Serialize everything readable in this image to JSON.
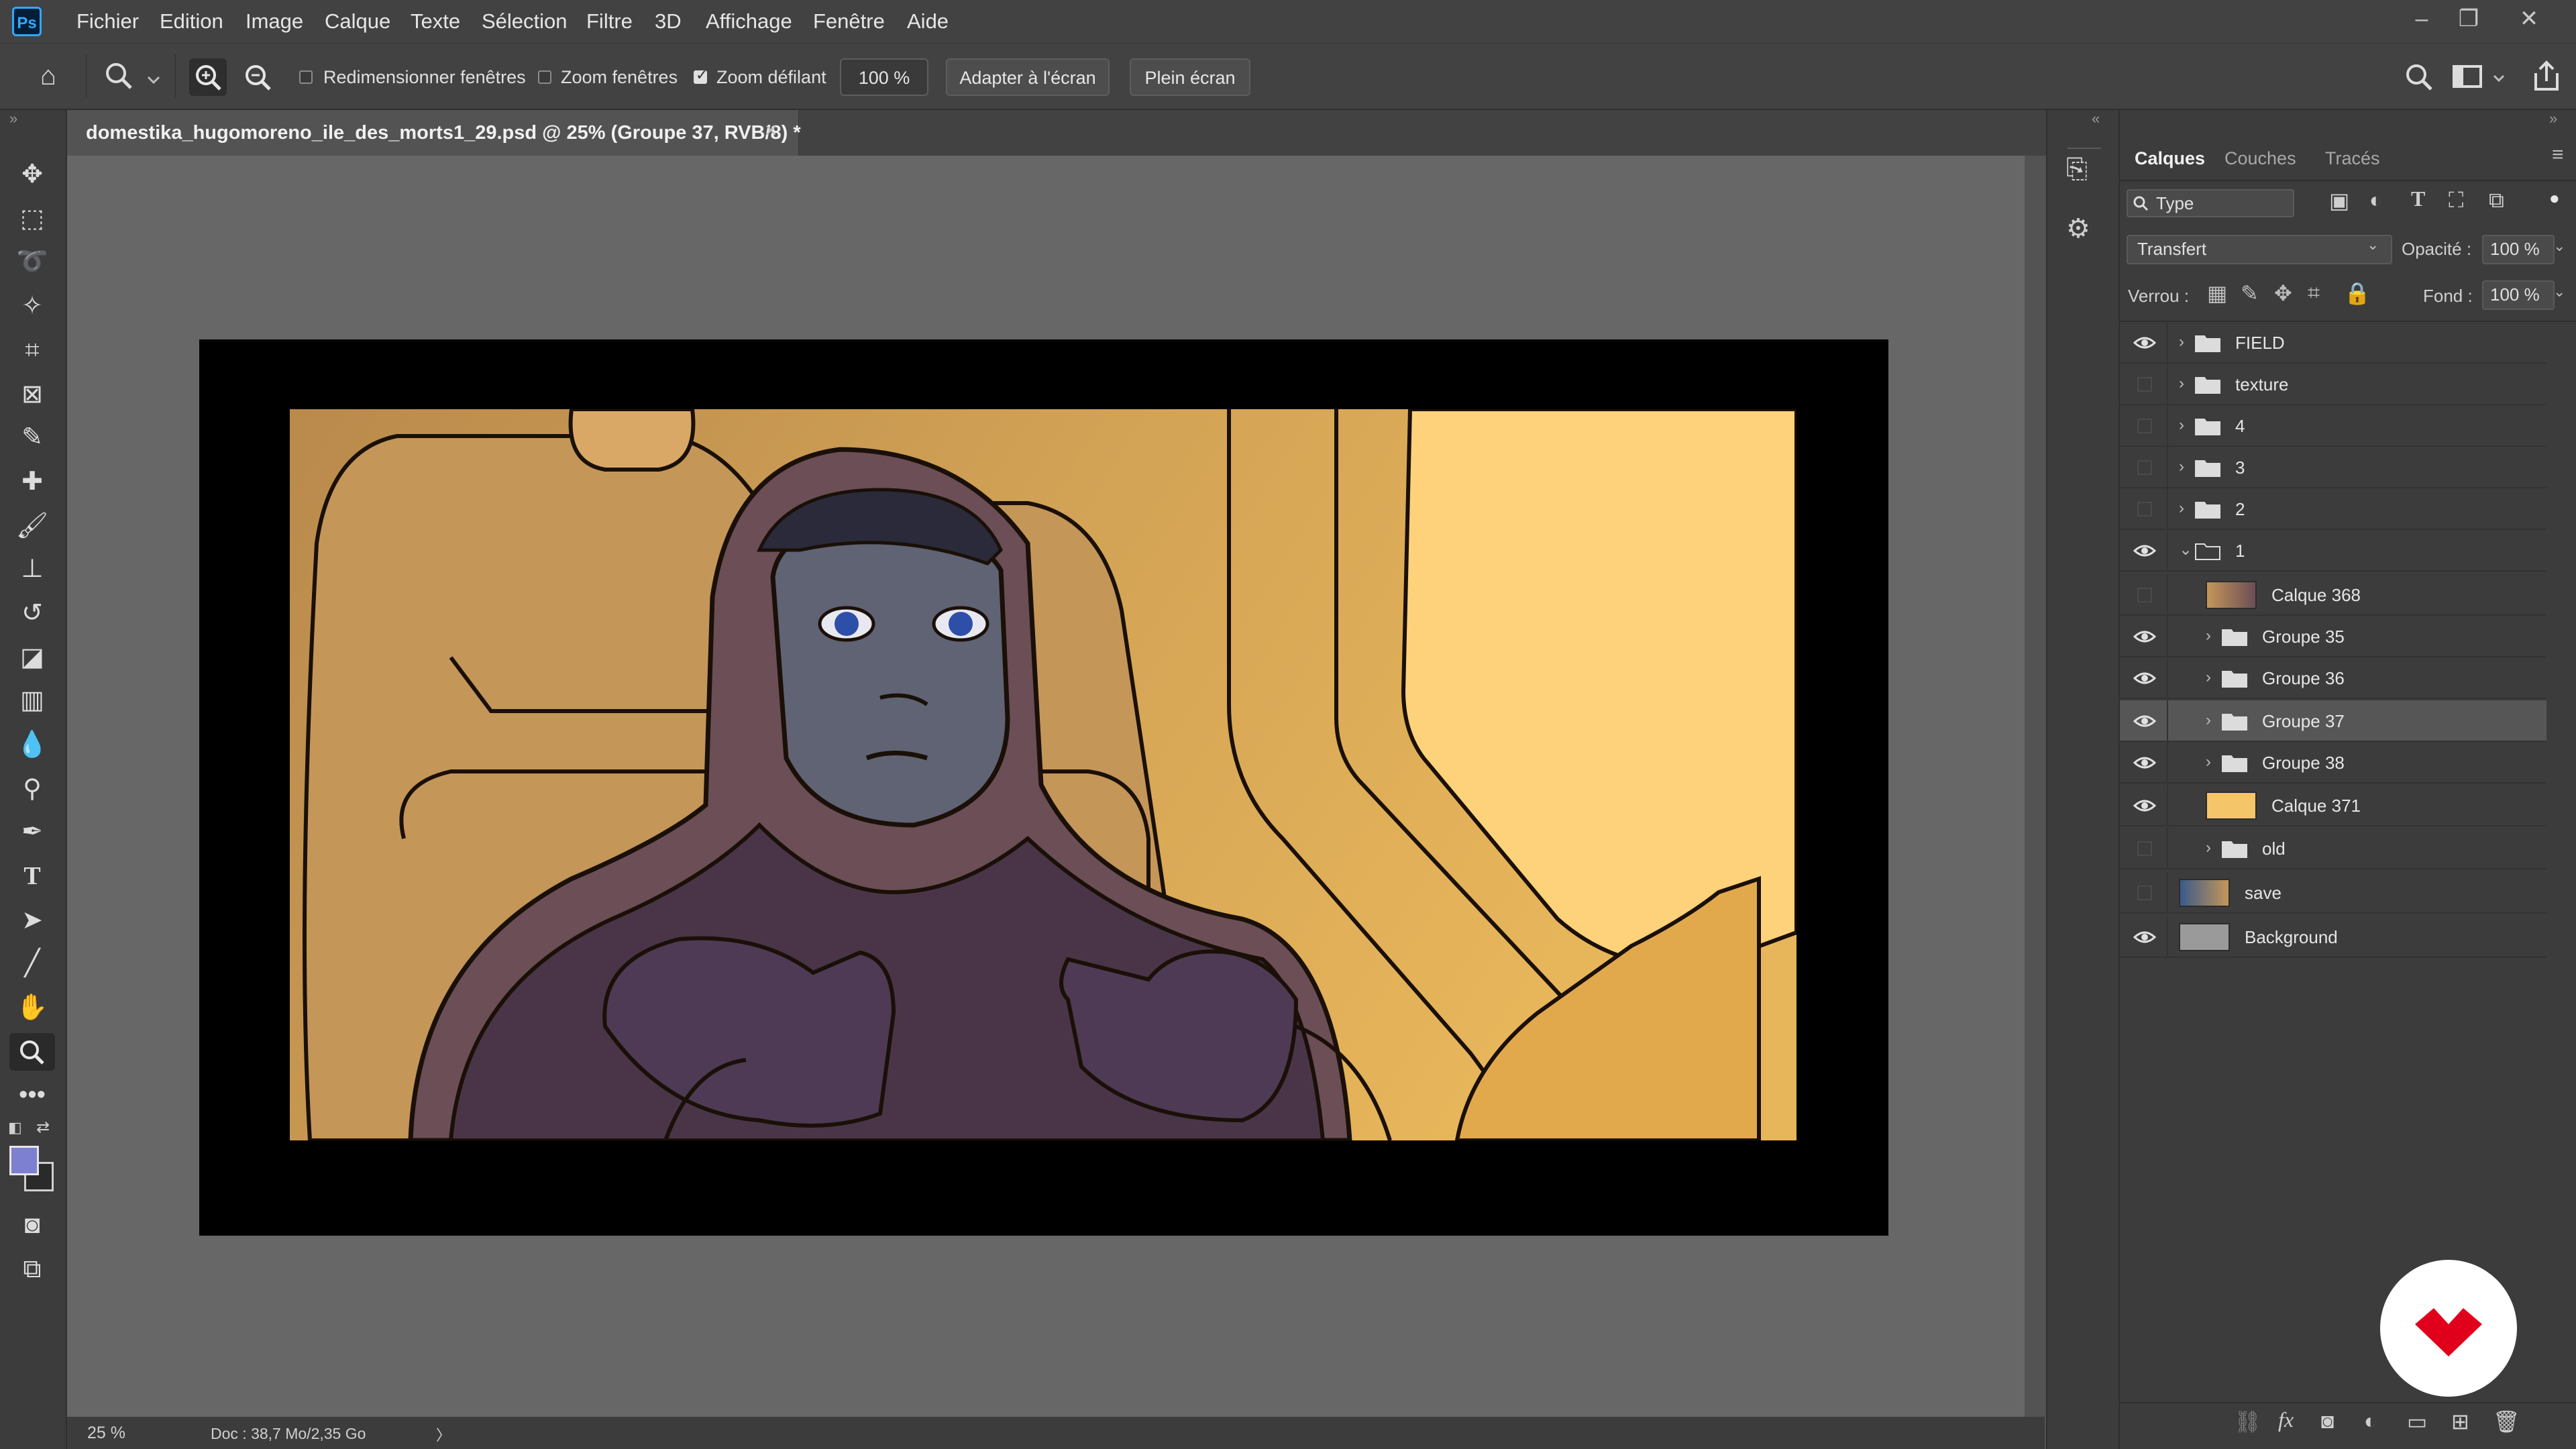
{
  "app": {
    "logo": "Ps"
  },
  "menu": [
    "Fichier",
    "Edition",
    "Image",
    "Calque",
    "Texte",
    "Sélection",
    "Filtre",
    "3D",
    "Affichage",
    "Fenêtre",
    "Aide"
  ],
  "options": {
    "resize_windows": "Redimensionner fenêtres",
    "zoom_all": "Zoom fenêtres",
    "scrubby_zoom": "Zoom défilant",
    "zoom_value": "100 %",
    "fit_screen": "Adapter à l'écran",
    "fill_screen": "Plein écran",
    "resize_windows_checked": false,
    "zoom_all_checked": false,
    "scrubby_zoom_checked": true
  },
  "document": {
    "tab_title": "domestika_hugomoreno_ile_des_morts1_29.psd @ 25% (Groupe 37, RVB/8) *",
    "close": "×"
  },
  "status": {
    "zoom": "25 %",
    "doc": "Doc : 38,7 Mo/2,35 Go",
    "arrow": "〉"
  },
  "panel": {
    "tabs": [
      "Calques",
      "Couches",
      "Tracés"
    ],
    "filter": "Type",
    "blend_mode": "Transfert",
    "opacity_label": "Opacité :",
    "opacity_value": "100 %",
    "lock_label": "Verrou :",
    "fill_label": "Fond :",
    "fill_value": "100 %"
  },
  "layers": [
    {
      "name": "FIELD",
      "type": "group",
      "visible": true,
      "indent": 0,
      "expanded": false
    },
    {
      "name": "texture",
      "type": "group",
      "visible": false,
      "indent": 0,
      "expanded": false
    },
    {
      "name": "4",
      "type": "group",
      "visible": false,
      "indent": 0,
      "expanded": false
    },
    {
      "name": "3",
      "type": "group",
      "visible": false,
      "indent": 0,
      "expanded": false
    },
    {
      "name": "2",
      "type": "group",
      "visible": false,
      "indent": 0,
      "expanded": false
    },
    {
      "name": "1",
      "type": "group",
      "visible": true,
      "indent": 0,
      "expanded": true
    },
    {
      "name": "Calque 368",
      "type": "layer",
      "visible": false,
      "indent": 1
    },
    {
      "name": "Groupe 35",
      "type": "group",
      "visible": true,
      "indent": 1,
      "expanded": false
    },
    {
      "name": "Groupe 36",
      "type": "group",
      "visible": true,
      "indent": 1,
      "expanded": false
    },
    {
      "name": "Groupe 37",
      "type": "group",
      "visible": true,
      "indent": 1,
      "expanded": false,
      "selected": true
    },
    {
      "name": "Groupe 38",
      "type": "group",
      "visible": true,
      "indent": 1,
      "expanded": false
    },
    {
      "name": "Calque 371",
      "type": "layer",
      "visible": true,
      "indent": 1
    },
    {
      "name": "old",
      "type": "group",
      "visible": false,
      "indent": 1,
      "expanded": false
    },
    {
      "name": "save",
      "type": "layer",
      "visible": false,
      "indent": 0
    },
    {
      "name": "Background",
      "type": "layer",
      "visible": true,
      "indent": 0
    }
  ],
  "colors": {
    "accent": "#31a8ff",
    "foreground": "#7d7fd1",
    "background_color": "#2a2a2a",
    "watermark": "#e0001b"
  }
}
